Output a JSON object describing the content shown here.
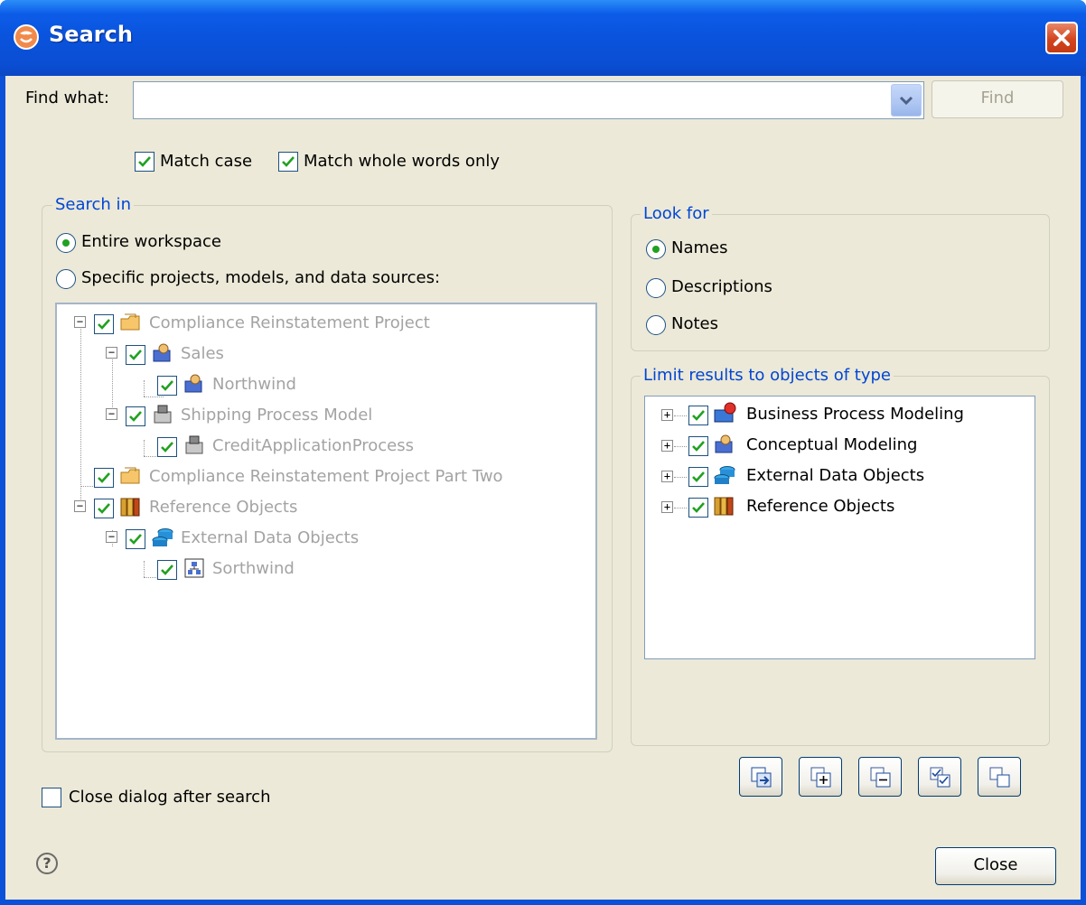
{
  "window": {
    "title": "Search",
    "close_icon": "close-x-icon"
  },
  "find": {
    "label": "Find what:",
    "value": "",
    "button": "Find"
  },
  "options": {
    "match_case": {
      "label": "Match case",
      "checked": true
    },
    "whole_words": {
      "label": "Match whole words only",
      "checked": true
    }
  },
  "search_in": {
    "title": "Search in",
    "entire_workspace": "Entire workspace",
    "specific": "Specific projects, models, and data sources:",
    "tree": [
      {
        "label": "Compliance Reinstatement Project",
        "icon": "folder-project-icon"
      },
      {
        "label": "Sales",
        "icon": "conceptual-model-icon"
      },
      {
        "label": "Northwind",
        "icon": "conceptual-model-icon"
      },
      {
        "label": "Shipping Process Model",
        "icon": "process-model-icon"
      },
      {
        "label": "CreditApplicationProcess",
        "icon": "process-model-icon"
      },
      {
        "label": "Compliance Reinstatement Project Part Two",
        "icon": "folder-project-icon"
      },
      {
        "label": "Reference Objects",
        "icon": "books-icon"
      },
      {
        "label": "External Data Objects",
        "icon": "database-icon"
      },
      {
        "label": "Sorthwind",
        "icon": "schema-icon"
      }
    ]
  },
  "look_for": {
    "title": "Look for",
    "names": "Names",
    "descriptions": "Descriptions",
    "notes": "Notes"
  },
  "limit": {
    "title": "Limit results to objects of type",
    "items": [
      {
        "label": "Business Process Modeling",
        "icon": "business-process-icon"
      },
      {
        "label": "Conceptual Modeling",
        "icon": "conceptual-model-icon"
      },
      {
        "label": "External Data Objects",
        "icon": "database-icon"
      },
      {
        "label": "Reference Objects",
        "icon": "books-icon"
      }
    ],
    "buttons": [
      "refresh-icon",
      "expand-all-icon",
      "collapse-all-icon",
      "check-all-icon",
      "uncheck-all-icon"
    ]
  },
  "close_after": {
    "label": "Close dialog after search",
    "checked": false
  },
  "footer": {
    "help": "?",
    "close_button": "Close"
  },
  "colors": {
    "title_blue": "#0a53dc",
    "dialog_bg": "#ece9d8",
    "group_title": "#0046d5"
  }
}
